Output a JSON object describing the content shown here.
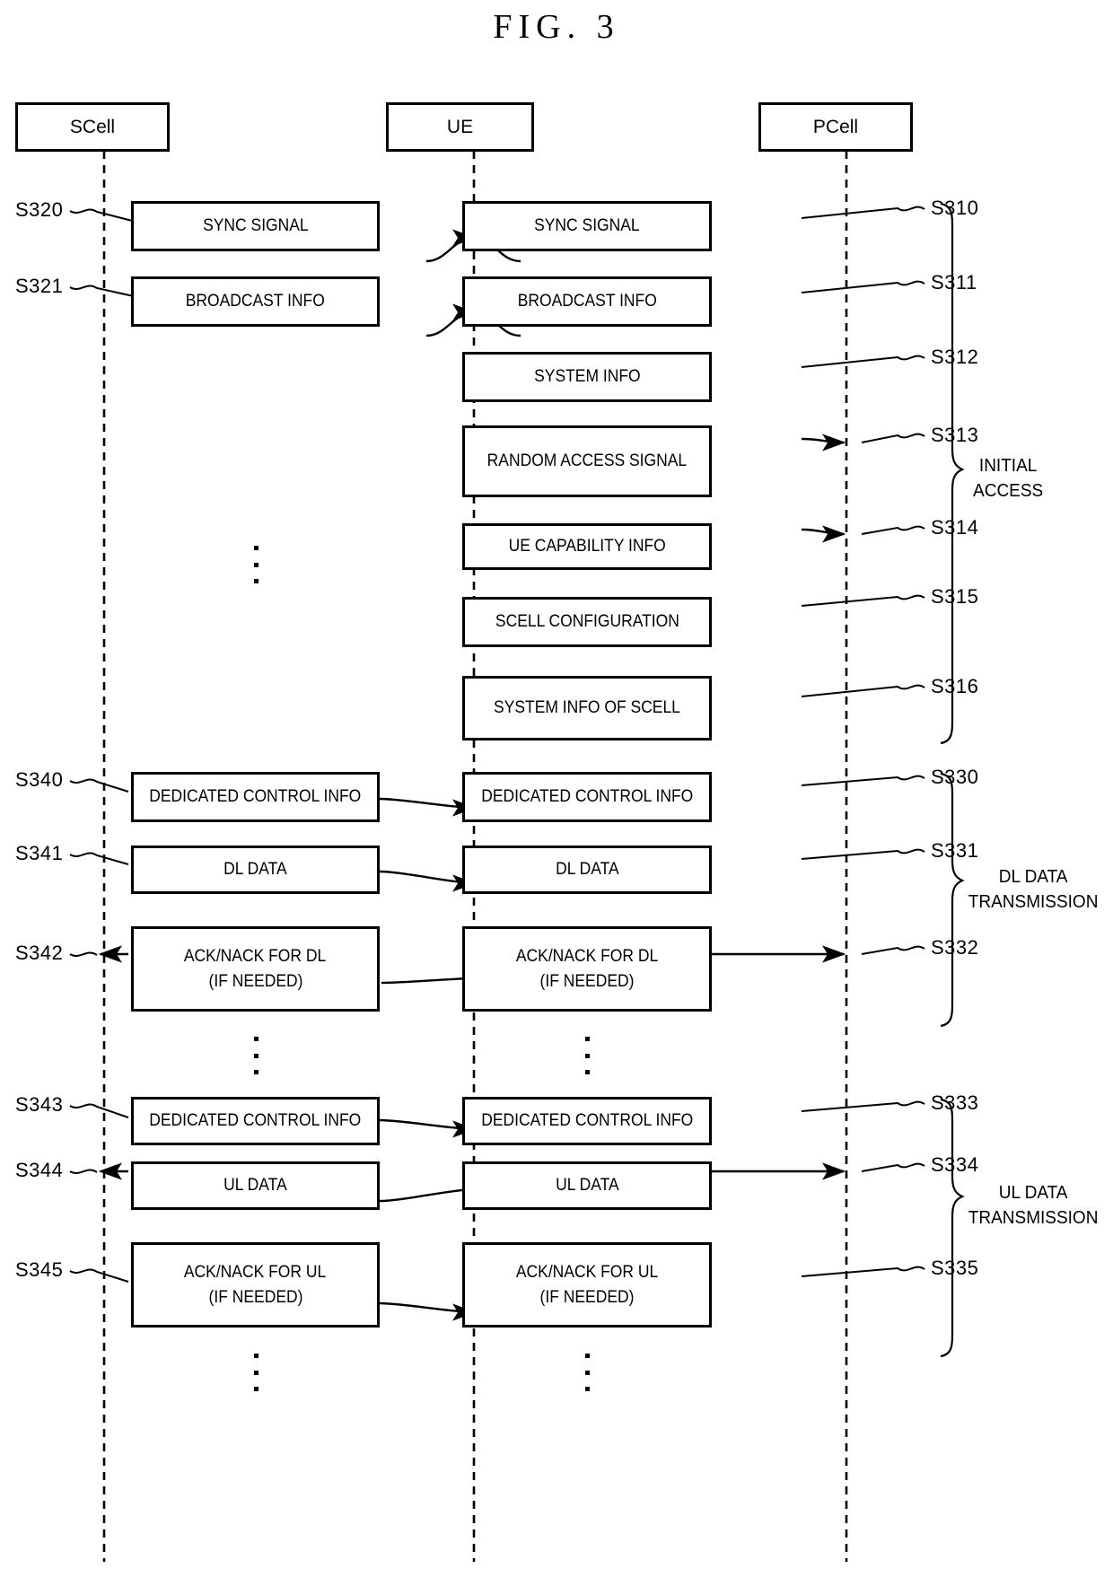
{
  "figure": {
    "title": "FIG. 3"
  },
  "entities": [
    {
      "id": "scell",
      "label": "SCell"
    },
    {
      "id": "ue",
      "label": "UE"
    },
    {
      "id": "pcell",
      "label": "PCell"
    }
  ],
  "groups": [
    {
      "id": "initial-access",
      "label_line1": "INITIAL",
      "label_line2": "ACCESS"
    },
    {
      "id": "dl-transmission",
      "label_line1": "DL DATA",
      "label_line2": "TRANSMISSION"
    },
    {
      "id": "ul-transmission",
      "label_line1": "UL DATA",
      "label_line2": "TRANSMISSION"
    }
  ],
  "messages": {
    "scell_sync": {
      "line1": "SYNC SIGNAL",
      "line2": ""
    },
    "pcell_sync": {
      "line1": "SYNC SIGNAL",
      "line2": ""
    },
    "scell_broadcast": {
      "line1": "BROADCAST INFO",
      "line2": ""
    },
    "pcell_broadcast": {
      "line1": "BROADCAST INFO",
      "line2": ""
    },
    "pcell_systeminfo": {
      "line1": "SYSTEM INFO",
      "line2": ""
    },
    "pcell_randomaccess": {
      "line1": "RANDOM ACCESS SIGNAL",
      "line2": ""
    },
    "pcell_uecapability": {
      "line1": "UE CAPABILITY INFO",
      "line2": ""
    },
    "pcell_scellconfig": {
      "line1": "SCELL CONFIGURATION",
      "line2": ""
    },
    "pcell_sysinfoscell": {
      "line1": "SYSTEM INFO OF SCELL",
      "line2": ""
    },
    "scell_dedctrl_dl": {
      "line1": "DEDICATED CONTROL INFO",
      "line2": ""
    },
    "pcell_dedctrl_dl": {
      "line1": "DEDICATED CONTROL INFO",
      "line2": ""
    },
    "scell_dldata": {
      "line1": "DL DATA",
      "line2": ""
    },
    "pcell_dldata": {
      "line1": "DL DATA",
      "line2": ""
    },
    "scell_acknack_dl": {
      "line1": "ACK/NACK FOR DL",
      "line2": "(IF NEEDED)"
    },
    "pcell_acknack_dl": {
      "line1": "ACK/NACK FOR DL",
      "line2": "(IF NEEDED)"
    },
    "scell_dedctrl_ul": {
      "line1": "DEDICATED CONTROL INFO",
      "line2": ""
    },
    "pcell_dedctrl_ul": {
      "line1": "DEDICATED CONTROL INFO",
      "line2": ""
    },
    "scell_uldata": {
      "line1": "UL DATA",
      "line2": ""
    },
    "pcell_uldata": {
      "line1": "UL DATA",
      "line2": ""
    },
    "scell_acknack_ul": {
      "line1": "ACK/NACK FOR UL",
      "line2": "(IF NEEDED)"
    },
    "pcell_acknack_ul": {
      "line1": "ACK/NACK FOR UL",
      "line2": "(IF NEEDED)"
    }
  },
  "step_labels": {
    "s310": "S310",
    "s311": "S311",
    "s312": "S312",
    "s313": "S313",
    "s314": "S314",
    "s315": "S315",
    "s316": "S316",
    "s320": "S320",
    "s321": "S321",
    "s330": "S330",
    "s331": "S331",
    "s332": "S332",
    "s333": "S333",
    "s334": "S334",
    "s335": "S335",
    "s340": "S340",
    "s341": "S341",
    "s342": "S342",
    "s343": "S343",
    "s344": "S344",
    "s345": "S345"
  },
  "colors": {
    "ink": "#000000",
    "paper": "#ffffff"
  }
}
